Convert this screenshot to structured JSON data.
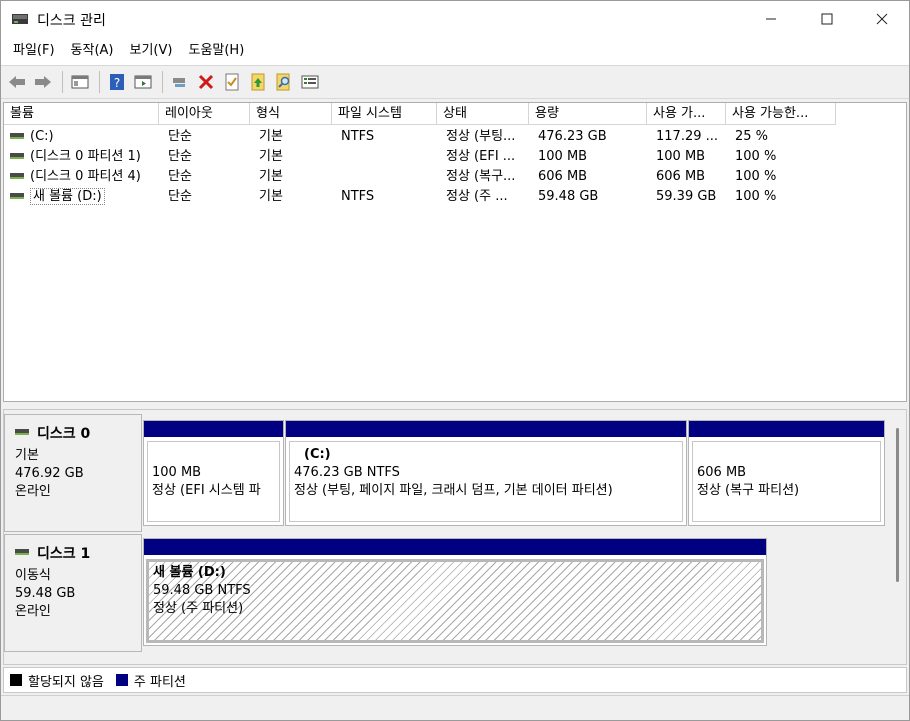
{
  "window": {
    "title": "디스크 관리"
  },
  "menu": [
    "파일(F)",
    "동작(A)",
    "보기(V)",
    "도움말(H)"
  ],
  "toolbar": {
    "icons": [
      "back-icon",
      "forward-icon",
      "console-tree-icon",
      "help-icon",
      "action-pane-icon",
      "connect-drive-icon",
      "delete-icon",
      "properties-icon",
      "import-icon",
      "search-icon",
      "view-icon"
    ]
  },
  "volumes": {
    "columns": [
      "볼륨",
      "레이아웃",
      "형식",
      "파일 시스템",
      "상태",
      "용량",
      "사용 가...",
      "사용 가능한..."
    ],
    "rows": [
      [
        "(C:)",
        "단순",
        "기본",
        "NTFS",
        "정상 (부팅...",
        "476.23 GB",
        "117.29 ...",
        "25 %"
      ],
      [
        "(디스크 0 파티션 1)",
        "단순",
        "기본",
        "",
        "정상 (EFI ...",
        "100 MB",
        "100 MB",
        "100 %"
      ],
      [
        "(디스크 0 파티션 4)",
        "단순",
        "기본",
        "",
        "정상 (복구...",
        "606 MB",
        "606 MB",
        "100 %"
      ],
      [
        "새 볼륨 (D:)",
        "단순",
        "기본",
        "NTFS",
        "정상 (주 ...",
        "59.48 GB",
        "59.39 GB",
        "100 %"
      ]
    ]
  },
  "disks": [
    {
      "name": "디스크 0",
      "type": "기본",
      "size": "476.92 GB",
      "status": "온라인",
      "partitions": [
        {
          "label": "",
          "size": "100 MB",
          "status": "정상 (EFI 시스템 파"
        },
        {
          "label": "(C:)",
          "size": "476.23 GB NTFS",
          "status": "정상 (부팅, 페이지 파일, 크래시 덤프, 기본 데이터 파티션)"
        },
        {
          "label": "",
          "size": "606 MB",
          "status": "정상 (복구 파티션)"
        }
      ]
    },
    {
      "name": "디스크 1",
      "type": "이동식",
      "size": "59.48 GB",
      "status": "온라인",
      "partitions": [
        {
          "label": "새 볼륨  (D:)",
          "size": "59.48 GB NTFS",
          "status": "정상 (주 파티션)"
        }
      ]
    }
  ],
  "legend": [
    {
      "label": "할당되지 않음",
      "color": "#000000"
    },
    {
      "label": "주 파티션",
      "color": "#000080"
    }
  ],
  "colors": {
    "primary_partition": "#000080",
    "unallocated": "#000000"
  }
}
